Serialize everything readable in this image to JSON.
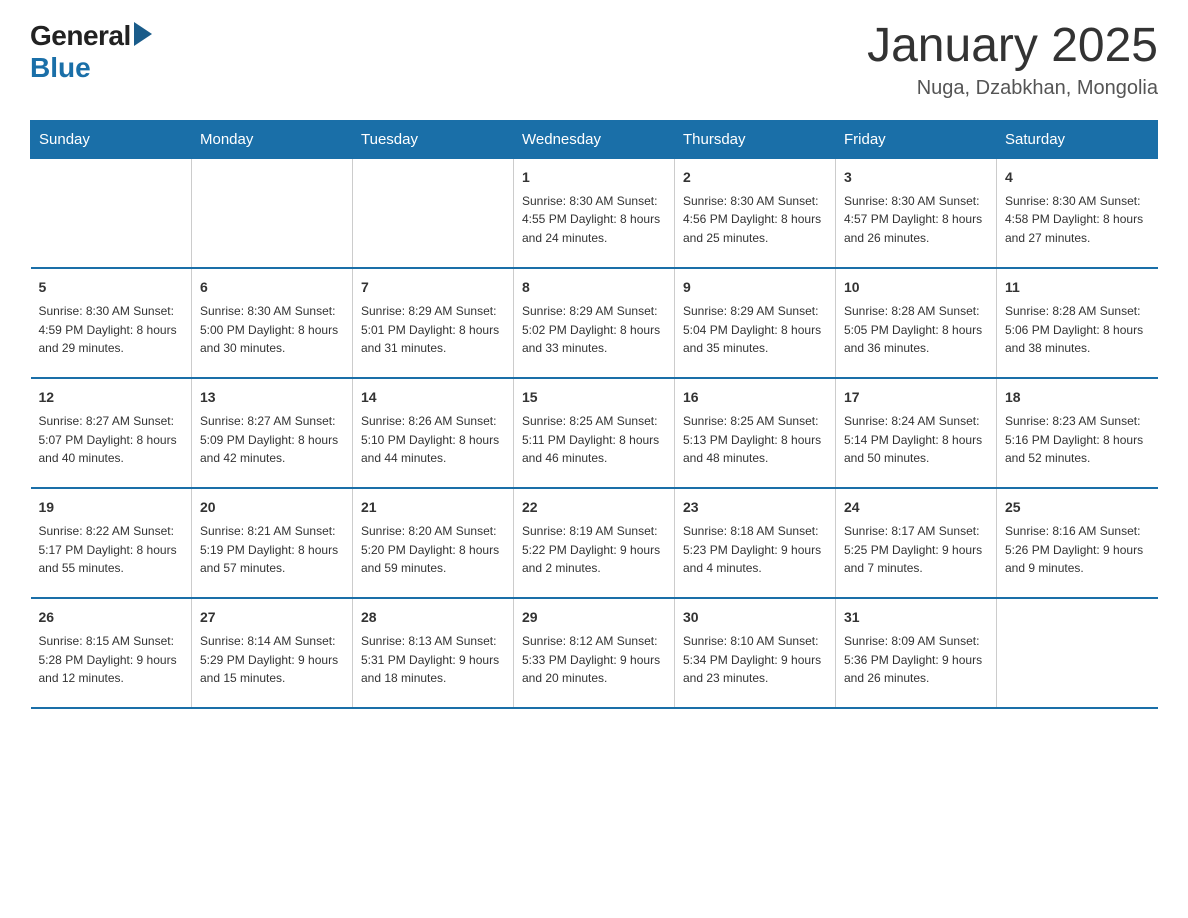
{
  "header": {
    "logo_general": "General",
    "logo_blue": "Blue",
    "title": "January 2025",
    "subtitle": "Nuga, Dzabkhan, Mongolia"
  },
  "days_of_week": [
    "Sunday",
    "Monday",
    "Tuesday",
    "Wednesday",
    "Thursday",
    "Friday",
    "Saturday"
  ],
  "weeks": [
    [
      {
        "day": "",
        "info": ""
      },
      {
        "day": "",
        "info": ""
      },
      {
        "day": "",
        "info": ""
      },
      {
        "day": "1",
        "info": "Sunrise: 8:30 AM\nSunset: 4:55 PM\nDaylight: 8 hours\nand 24 minutes."
      },
      {
        "day": "2",
        "info": "Sunrise: 8:30 AM\nSunset: 4:56 PM\nDaylight: 8 hours\nand 25 minutes."
      },
      {
        "day": "3",
        "info": "Sunrise: 8:30 AM\nSunset: 4:57 PM\nDaylight: 8 hours\nand 26 minutes."
      },
      {
        "day": "4",
        "info": "Sunrise: 8:30 AM\nSunset: 4:58 PM\nDaylight: 8 hours\nand 27 minutes."
      }
    ],
    [
      {
        "day": "5",
        "info": "Sunrise: 8:30 AM\nSunset: 4:59 PM\nDaylight: 8 hours\nand 29 minutes."
      },
      {
        "day": "6",
        "info": "Sunrise: 8:30 AM\nSunset: 5:00 PM\nDaylight: 8 hours\nand 30 minutes."
      },
      {
        "day": "7",
        "info": "Sunrise: 8:29 AM\nSunset: 5:01 PM\nDaylight: 8 hours\nand 31 minutes."
      },
      {
        "day": "8",
        "info": "Sunrise: 8:29 AM\nSunset: 5:02 PM\nDaylight: 8 hours\nand 33 minutes."
      },
      {
        "day": "9",
        "info": "Sunrise: 8:29 AM\nSunset: 5:04 PM\nDaylight: 8 hours\nand 35 minutes."
      },
      {
        "day": "10",
        "info": "Sunrise: 8:28 AM\nSunset: 5:05 PM\nDaylight: 8 hours\nand 36 minutes."
      },
      {
        "day": "11",
        "info": "Sunrise: 8:28 AM\nSunset: 5:06 PM\nDaylight: 8 hours\nand 38 minutes."
      }
    ],
    [
      {
        "day": "12",
        "info": "Sunrise: 8:27 AM\nSunset: 5:07 PM\nDaylight: 8 hours\nand 40 minutes."
      },
      {
        "day": "13",
        "info": "Sunrise: 8:27 AM\nSunset: 5:09 PM\nDaylight: 8 hours\nand 42 minutes."
      },
      {
        "day": "14",
        "info": "Sunrise: 8:26 AM\nSunset: 5:10 PM\nDaylight: 8 hours\nand 44 minutes."
      },
      {
        "day": "15",
        "info": "Sunrise: 8:25 AM\nSunset: 5:11 PM\nDaylight: 8 hours\nand 46 minutes."
      },
      {
        "day": "16",
        "info": "Sunrise: 8:25 AM\nSunset: 5:13 PM\nDaylight: 8 hours\nand 48 minutes."
      },
      {
        "day": "17",
        "info": "Sunrise: 8:24 AM\nSunset: 5:14 PM\nDaylight: 8 hours\nand 50 minutes."
      },
      {
        "day": "18",
        "info": "Sunrise: 8:23 AM\nSunset: 5:16 PM\nDaylight: 8 hours\nand 52 minutes."
      }
    ],
    [
      {
        "day": "19",
        "info": "Sunrise: 8:22 AM\nSunset: 5:17 PM\nDaylight: 8 hours\nand 55 minutes."
      },
      {
        "day": "20",
        "info": "Sunrise: 8:21 AM\nSunset: 5:19 PM\nDaylight: 8 hours\nand 57 minutes."
      },
      {
        "day": "21",
        "info": "Sunrise: 8:20 AM\nSunset: 5:20 PM\nDaylight: 8 hours\nand 59 minutes."
      },
      {
        "day": "22",
        "info": "Sunrise: 8:19 AM\nSunset: 5:22 PM\nDaylight: 9 hours\nand 2 minutes."
      },
      {
        "day": "23",
        "info": "Sunrise: 8:18 AM\nSunset: 5:23 PM\nDaylight: 9 hours\nand 4 minutes."
      },
      {
        "day": "24",
        "info": "Sunrise: 8:17 AM\nSunset: 5:25 PM\nDaylight: 9 hours\nand 7 minutes."
      },
      {
        "day": "25",
        "info": "Sunrise: 8:16 AM\nSunset: 5:26 PM\nDaylight: 9 hours\nand 9 minutes."
      }
    ],
    [
      {
        "day": "26",
        "info": "Sunrise: 8:15 AM\nSunset: 5:28 PM\nDaylight: 9 hours\nand 12 minutes."
      },
      {
        "day": "27",
        "info": "Sunrise: 8:14 AM\nSunset: 5:29 PM\nDaylight: 9 hours\nand 15 minutes."
      },
      {
        "day": "28",
        "info": "Sunrise: 8:13 AM\nSunset: 5:31 PM\nDaylight: 9 hours\nand 18 minutes."
      },
      {
        "day": "29",
        "info": "Sunrise: 8:12 AM\nSunset: 5:33 PM\nDaylight: 9 hours\nand 20 minutes."
      },
      {
        "day": "30",
        "info": "Sunrise: 8:10 AM\nSunset: 5:34 PM\nDaylight: 9 hours\nand 23 minutes."
      },
      {
        "day": "31",
        "info": "Sunrise: 8:09 AM\nSunset: 5:36 PM\nDaylight: 9 hours\nand 26 minutes."
      },
      {
        "day": "",
        "info": ""
      }
    ]
  ]
}
